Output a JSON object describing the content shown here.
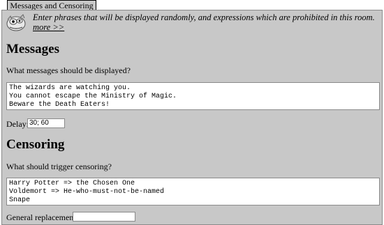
{
  "tab": {
    "label": "Messages and Censoring"
  },
  "intro": {
    "text": "Enter phrases that will be displayed randomly, and expressions which are prohibited in this room.",
    "more_label": "more >>"
  },
  "messages": {
    "heading": "Messages",
    "question": "What messages should be displayed?",
    "lines": "The wizards are watching you.\nYou cannot escape the Ministry of Magic.\nBeware the Death Eaters!",
    "delay_label": "Delay:",
    "delay_value": "30; 60"
  },
  "censoring": {
    "heading": "Censoring",
    "question": "What should trigger censoring?",
    "rules": "Harry Potter => the Chosen One\nVoldemort => He-who-must-not-be-named\nSnape",
    "replacement_label": "General replacement:",
    "replacement_value": ""
  },
  "icons": {
    "logo": "creature-logo-icon"
  },
  "colors": {
    "panel": "#c8c8c8",
    "tab": "#c8c8c8",
    "field": "#ffffff",
    "border": "#8a8a8a"
  }
}
